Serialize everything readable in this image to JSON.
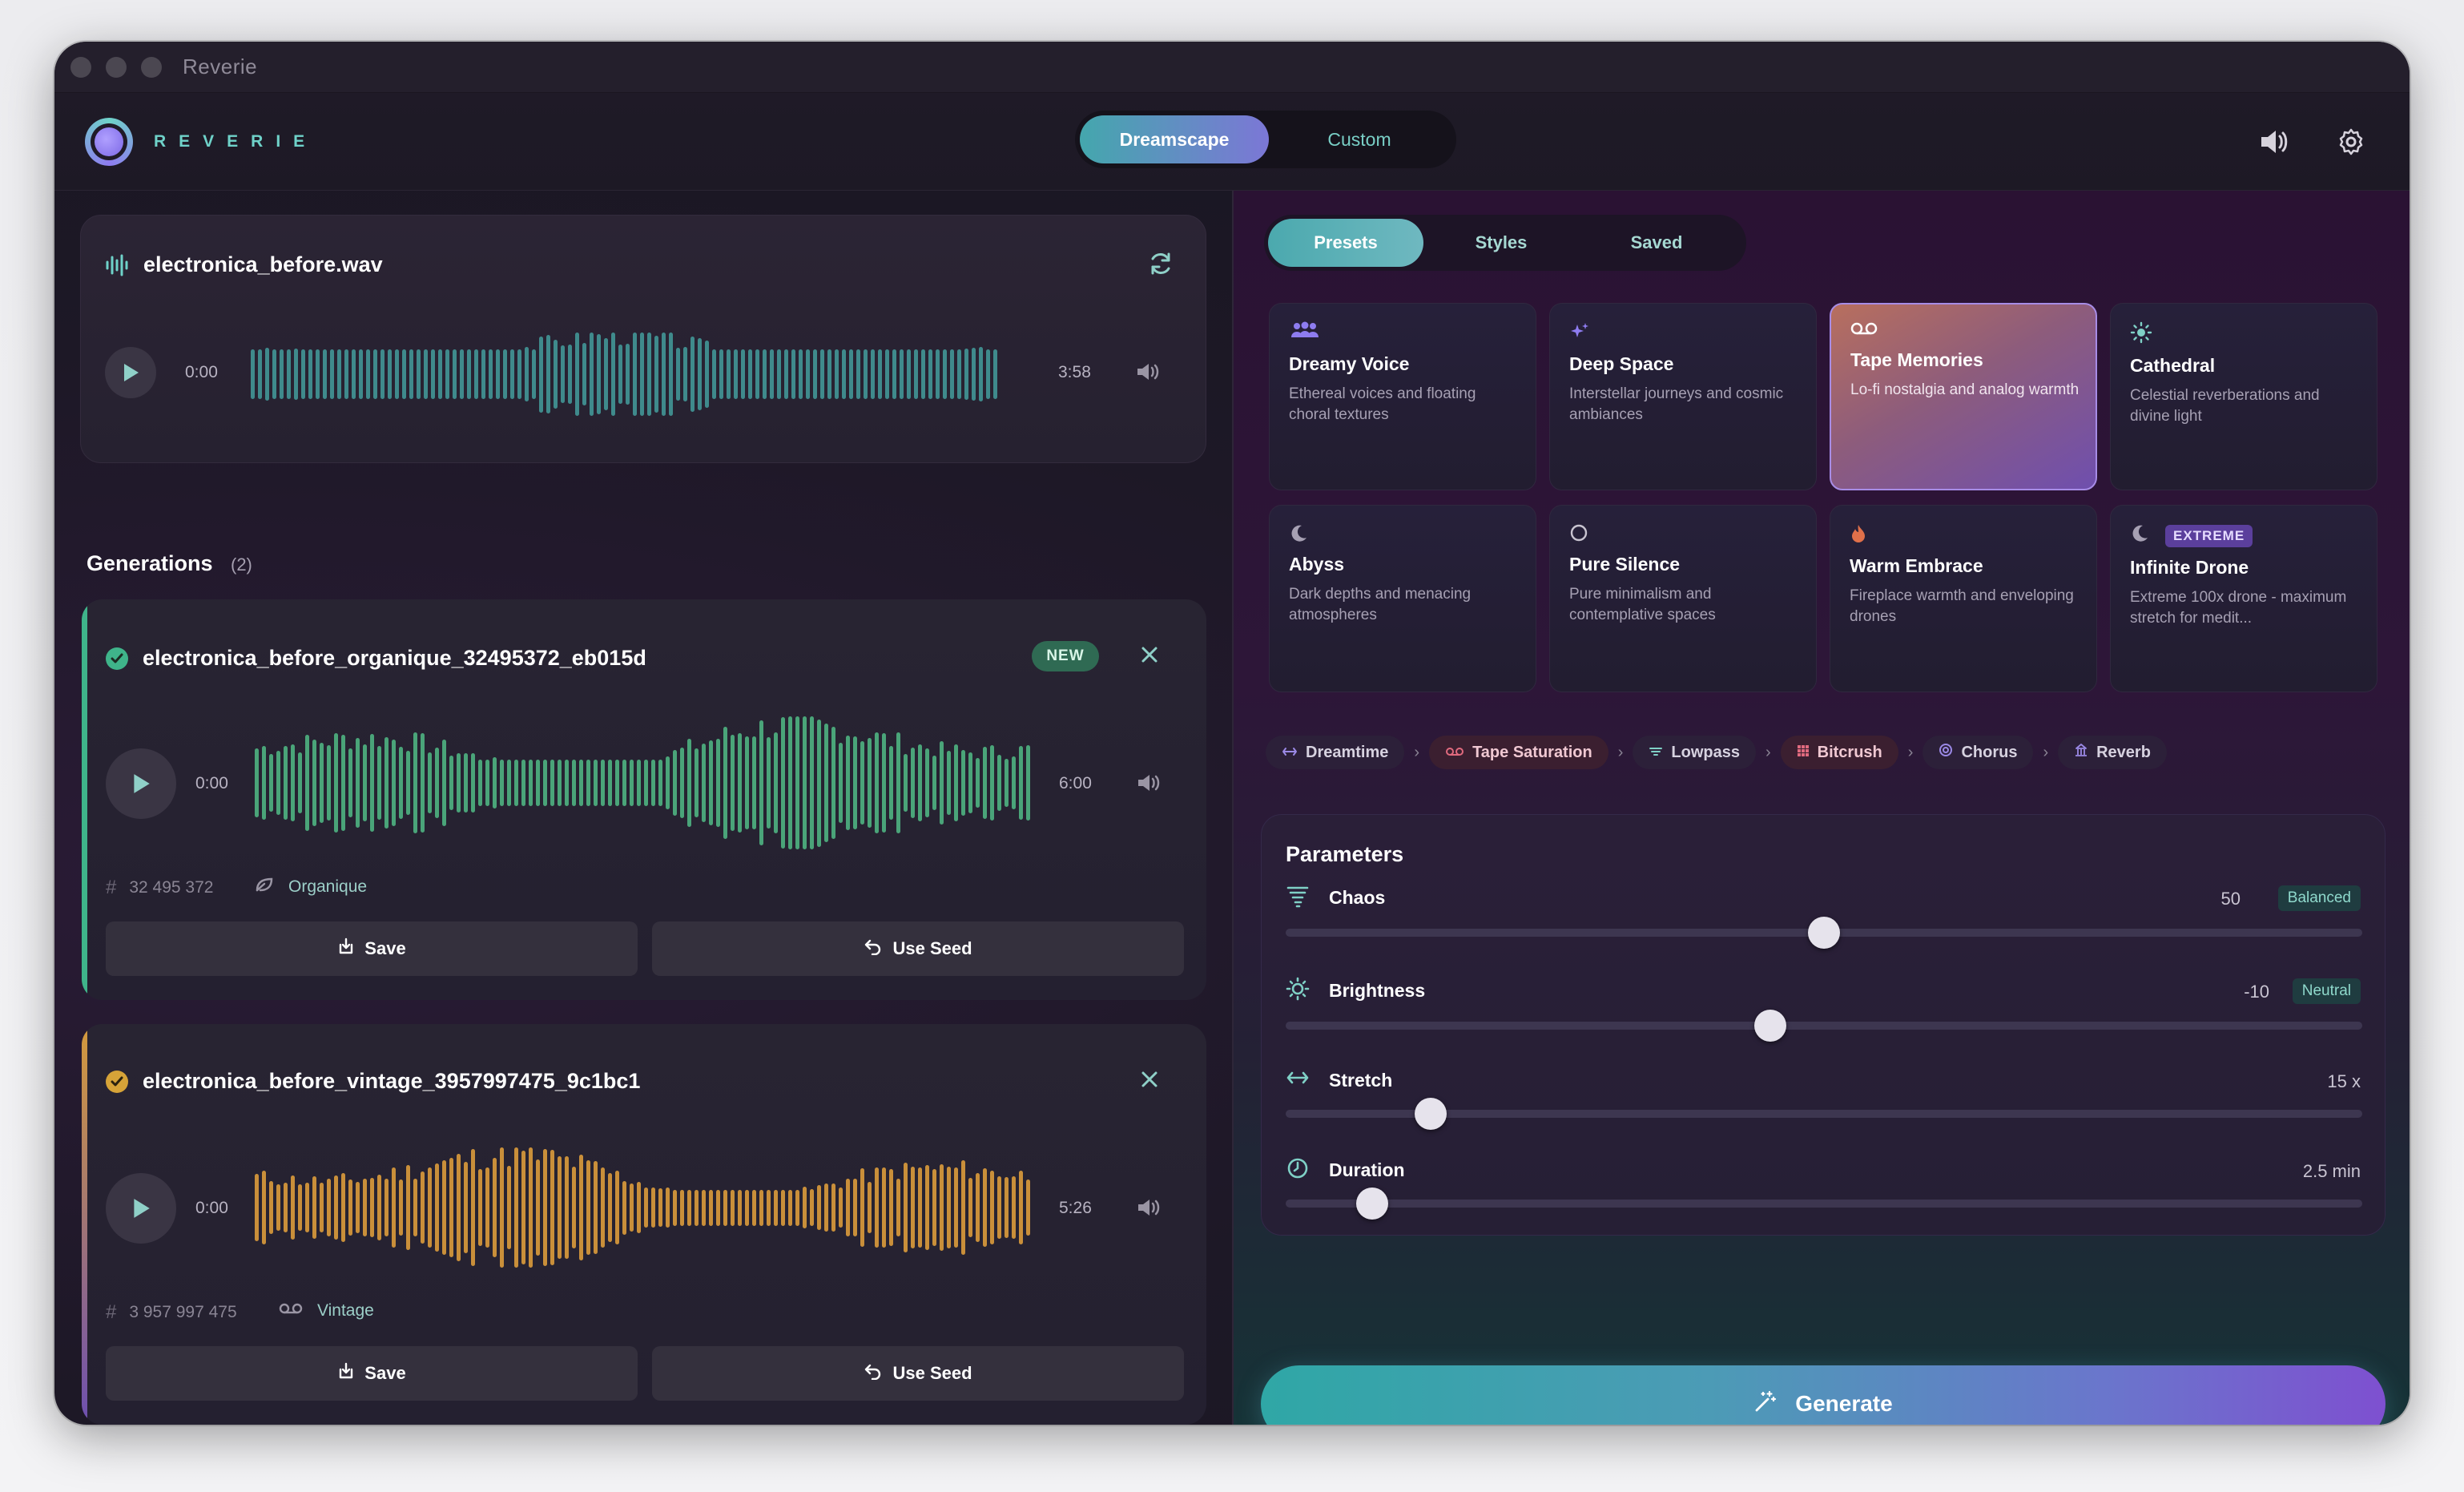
{
  "window": {
    "title": "Reverie"
  },
  "header": {
    "logo_text": "REVERIE",
    "modes": [
      {
        "label": "Dreamscape",
        "active": true
      },
      {
        "label": "Custom",
        "active": false
      }
    ],
    "icons": [
      "speaker-icon",
      "settings-icon"
    ]
  },
  "source": {
    "filename": "electronica_before.wav",
    "current_time": "0:00",
    "duration": "3:58"
  },
  "generations": {
    "heading": "Generations",
    "count": "(2)",
    "items": [
      {
        "title": "electronica_before_organique_32495372_eb015d",
        "badge": "NEW",
        "current_time": "0:00",
        "duration": "6:00",
        "seed": "32 495 372",
        "style": "Organique",
        "save_label": "Save",
        "seed_label": "Use Seed",
        "color": "#4fb98a"
      },
      {
        "title": "electronica_before_vintage_3957997475_9c1bc1",
        "current_time": "0:00",
        "duration": "5:26",
        "seed": "3 957 997 475",
        "style": "Vintage",
        "save_label": "Save",
        "seed_label": "Use Seed",
        "color": "#d49a3b"
      }
    ]
  },
  "tabs": [
    {
      "label": "Presets",
      "active": true
    },
    {
      "label": "Styles",
      "active": false
    },
    {
      "label": "Saved",
      "active": false
    }
  ],
  "presets": [
    {
      "name": "Dreamy Voice",
      "desc": "Ethereal voices and floating choral textures",
      "icon": "people-icon"
    },
    {
      "name": "Deep Space",
      "desc": "Interstellar journeys and cosmic ambiances",
      "icon": "sparkle-icon"
    },
    {
      "name": "Tape Memories",
      "desc": "Lo-fi nostalgia and analog warmth",
      "icon": "tape-icon",
      "selected": true
    },
    {
      "name": "Cathedral",
      "desc": "Celestial reverberations and divine light",
      "icon": "sun-icon"
    },
    {
      "name": "Abyss",
      "desc": "Dark depths and menacing atmospheres",
      "icon": "moon-icon"
    },
    {
      "name": "Pure Silence",
      "desc": "Pure minimalism and contemplative spaces",
      "icon": "circle-icon"
    },
    {
      "name": "Warm Embrace",
      "desc": "Fireplace warmth and enveloping drones",
      "icon": "flame-icon"
    },
    {
      "name": "Infinite Drone",
      "desc": "Extreme 100x drone - maximum stretch for medit...",
      "icon": "moon-icon",
      "badge": "EXTREME"
    }
  ],
  "chain": [
    {
      "label": "Dreamtime",
      "icon": "arrows-icon"
    },
    {
      "label": "Tape Saturation",
      "icon": "tape-icon"
    },
    {
      "label": "Lowpass",
      "icon": "filter-icon"
    },
    {
      "label": "Bitcrush",
      "icon": "grid-icon"
    },
    {
      "label": "Chorus",
      "icon": "chorus-icon"
    },
    {
      "label": "Reverb",
      "icon": "building-icon"
    }
  ],
  "parameters": {
    "title": "Parameters",
    "items": [
      {
        "label": "Chaos",
        "value": "50",
        "tag": "Balanced",
        "level": 0.5
      },
      {
        "label": "Brightness",
        "value": "-10",
        "tag": "Neutral",
        "level": 0.45
      },
      {
        "label": "Stretch",
        "value": "15 x",
        "level": 0.135
      },
      {
        "label": "Duration",
        "value": "2.5 min",
        "level": 0.08
      }
    ]
  },
  "generate_label": "Generate"
}
